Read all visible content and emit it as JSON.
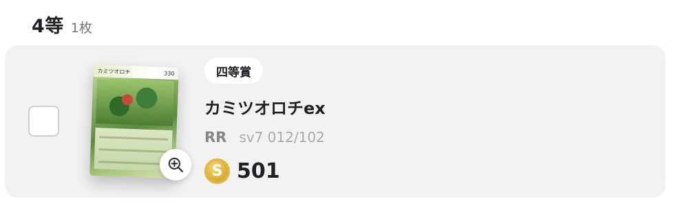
{
  "header": {
    "rank": "4等",
    "count": "1枚"
  },
  "item": {
    "prize_label": "四等賞",
    "card_name": "カミツオロチex",
    "rarity": "RR",
    "set_code": "sv7 012/102",
    "card_top_name": "カミツオロチ",
    "card_top_hp": "330",
    "points": "501",
    "coin_symbol": "S"
  },
  "colors": {
    "panel_bg": "#f2f2f2",
    "coin": "#d4a52b"
  }
}
